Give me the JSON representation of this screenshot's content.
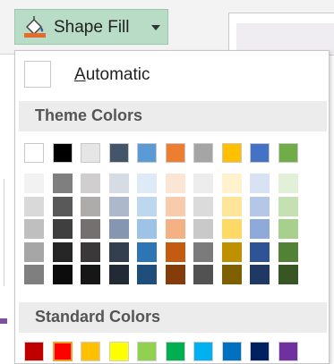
{
  "button": {
    "label": "Shape Fill"
  },
  "automatic": {
    "label_prefix": "A",
    "label_rest": "utomatic"
  },
  "theme_header": "Theme Colors",
  "standard_header": "Standard Colors",
  "colors": {
    "button_bg": "#b8dcc6",
    "bucket_fill": "#e66c2c",
    "selected_outline": "#f0a030"
  },
  "theme_columns": [
    {
      "name": "white",
      "shades": [
        "#ffffff",
        "#f2f2f2",
        "#d9d9d9",
        "#bfbfbf",
        "#a6a6a6",
        "#7f7f7f"
      ]
    },
    {
      "name": "black",
      "shades": [
        "#000000",
        "#7f7f7f",
        "#595959",
        "#3f3f3f",
        "#262626",
        "#0c0c0c"
      ]
    },
    {
      "name": "light-gray",
      "shades": [
        "#e7e6e6",
        "#d0cece",
        "#aeabab",
        "#757070",
        "#3a3838",
        "#171616"
      ]
    },
    {
      "name": "dark-blue",
      "shades": [
        "#44546a",
        "#d6dce4",
        "#adb9ca",
        "#8496b0",
        "#333f4f",
        "#222a35"
      ]
    },
    {
      "name": "blue",
      "shades": [
        "#5b9bd5",
        "#deebf6",
        "#bdd7ee",
        "#9dc3e6",
        "#2e75b5",
        "#1e4e79"
      ]
    },
    {
      "name": "orange",
      "shades": [
        "#ed7d31",
        "#fbe5d5",
        "#f8cbad",
        "#f4b183",
        "#c55a11",
        "#843c0b"
      ]
    },
    {
      "name": "gray",
      "shades": [
        "#a5a5a5",
        "#ededed",
        "#dbdbdb",
        "#c9c9c9",
        "#7b7b7b",
        "#525252"
      ]
    },
    {
      "name": "gold",
      "shades": [
        "#ffc000",
        "#fff2cc",
        "#fee599",
        "#ffd965",
        "#bf9000",
        "#7f6000"
      ]
    },
    {
      "name": "medium-blue",
      "shades": [
        "#4472c4",
        "#d9e2f3",
        "#b4c7e7",
        "#8eaadb",
        "#2f5496",
        "#1f3864"
      ]
    },
    {
      "name": "green",
      "shades": [
        "#70ad47",
        "#e2efd9",
        "#c5e0b3",
        "#a8d08d",
        "#538135",
        "#375623"
      ]
    }
  ],
  "standard_colors": [
    {
      "name": "dark-red",
      "color": "#c00000",
      "selected": false
    },
    {
      "name": "red",
      "color": "#ff0000",
      "selected": true
    },
    {
      "name": "orange",
      "color": "#ffc000",
      "selected": false
    },
    {
      "name": "yellow",
      "color": "#ffff00",
      "selected": false
    },
    {
      "name": "light-green",
      "color": "#92d050",
      "selected": false
    },
    {
      "name": "green",
      "color": "#00b050",
      "selected": false
    },
    {
      "name": "light-blue",
      "color": "#00b0f0",
      "selected": false
    },
    {
      "name": "blue",
      "color": "#0070c0",
      "selected": false
    },
    {
      "name": "dark-blue",
      "color": "#002060",
      "selected": false
    },
    {
      "name": "purple",
      "color": "#7030a0",
      "selected": false
    }
  ]
}
